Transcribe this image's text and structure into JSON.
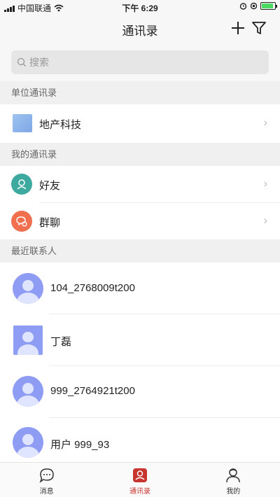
{
  "status_bar": {
    "carrier": "中国联通",
    "time": "下午 6:29",
    "battery_level": 0.9
  },
  "nav": {
    "title": "通讯录"
  },
  "search": {
    "placeholder": "搜索"
  },
  "sections": {
    "org": {
      "header": "单位通讯录",
      "items": [
        {
          "label": "地产科技"
        }
      ]
    },
    "mine": {
      "header": "我的通讯录",
      "items": [
        {
          "label": "好友",
          "icon": "friend-icon",
          "color": "#3ea99f"
        },
        {
          "label": "群聊",
          "icon": "group-chat-icon",
          "color": "#ef6f4f"
        }
      ]
    },
    "recent": {
      "header": "最近联系人",
      "contacts": [
        {
          "name": "104_2768009t200",
          "avatar_shape": "circle"
        },
        {
          "name": "丁磊",
          "avatar_shape": "square"
        },
        {
          "name": "999_2764921t200",
          "avatar_shape": "circle"
        },
        {
          "name": "用户 999_93",
          "avatar_shape": "circle"
        }
      ]
    }
  },
  "tabs": [
    {
      "label": "消息",
      "icon": "message-icon",
      "active": false
    },
    {
      "label": "通讯录",
      "icon": "contacts-icon",
      "active": true
    },
    {
      "label": "我的",
      "icon": "profile-icon",
      "active": false
    }
  ],
  "colors": {
    "accent": "#c8352f",
    "avatar": "#8e9cf3"
  }
}
